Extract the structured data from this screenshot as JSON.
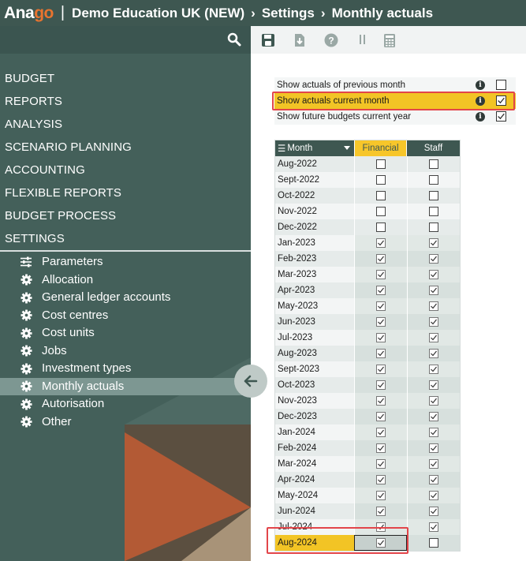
{
  "app": {
    "logo_part1": "Ana",
    "logo_part2": "go",
    "separator": "|",
    "org": "Demo Education UK (NEW)",
    "section": "Settings",
    "page": "Monthly actuals"
  },
  "menu": [
    {
      "label": "BUDGET"
    },
    {
      "label": "REPORTS"
    },
    {
      "label": "ANALYSIS"
    },
    {
      "label": "SCENARIO PLANNING"
    },
    {
      "label": "ACCOUNTING"
    },
    {
      "label": "FLEXIBLE REPORTS"
    },
    {
      "label": "BUDGET PROCESS"
    },
    {
      "label": "SETTINGS"
    }
  ],
  "submenu": [
    {
      "label": "Parameters",
      "icon": "sliders-icon"
    },
    {
      "label": "Allocation",
      "icon": "gear-icon"
    },
    {
      "label": "General ledger accounts",
      "icon": "gear-icon"
    },
    {
      "label": "Cost centres",
      "icon": "gear-icon"
    },
    {
      "label": "Cost units",
      "icon": "gear-icon"
    },
    {
      "label": "Jobs",
      "icon": "gear-icon"
    },
    {
      "label": "Investment types",
      "icon": "gear-icon"
    },
    {
      "label": "Monthly actuals",
      "icon": "gear-icon",
      "active": true
    },
    {
      "label": "Autorisation",
      "icon": "gear-icon"
    },
    {
      "label": "Other",
      "icon": "gear-icon"
    }
  ],
  "toolbar": {
    "icons": [
      "save-icon",
      "download-icon",
      "help-icon",
      "columns-icon",
      "calculator-icon"
    ]
  },
  "options": [
    {
      "label": "Show actuals of previous month",
      "checked": false
    },
    {
      "label": "Show actuals current month",
      "checked": true,
      "highlighted": true
    },
    {
      "label": "Show future budgets current year",
      "checked": true
    }
  ],
  "table": {
    "headers": {
      "month": "Month",
      "financial": "Financial",
      "staff": "Staff"
    },
    "rows": [
      {
        "month": "Aug-2022",
        "financial": false,
        "staff": false
      },
      {
        "month": "Sept-2022",
        "financial": false,
        "staff": false
      },
      {
        "month": "Oct-2022",
        "financial": false,
        "staff": false
      },
      {
        "month": "Nov-2022",
        "financial": false,
        "staff": false
      },
      {
        "month": "Dec-2022",
        "financial": false,
        "staff": false
      },
      {
        "month": "Jan-2023",
        "financial": true,
        "staff": true
      },
      {
        "month": "Feb-2023",
        "financial": true,
        "staff": true
      },
      {
        "month": "Mar-2023",
        "financial": true,
        "staff": true
      },
      {
        "month": "Apr-2023",
        "financial": true,
        "staff": true
      },
      {
        "month": "May-2023",
        "financial": true,
        "staff": true
      },
      {
        "month": "Jun-2023",
        "financial": true,
        "staff": true
      },
      {
        "month": "Jul-2023",
        "financial": true,
        "staff": true
      },
      {
        "month": "Aug-2023",
        "financial": true,
        "staff": true
      },
      {
        "month": "Sept-2023",
        "financial": true,
        "staff": true
      },
      {
        "month": "Oct-2023",
        "financial": true,
        "staff": true
      },
      {
        "month": "Nov-2023",
        "financial": true,
        "staff": true
      },
      {
        "month": "Dec-2023",
        "financial": true,
        "staff": true
      },
      {
        "month": "Jan-2024",
        "financial": true,
        "staff": true
      },
      {
        "month": "Feb-2024",
        "financial": true,
        "staff": true
      },
      {
        "month": "Mar-2024",
        "financial": true,
        "staff": true
      },
      {
        "month": "Apr-2024",
        "financial": true,
        "staff": true
      },
      {
        "month": "May-2024",
        "financial": true,
        "staff": true
      },
      {
        "month": "Jun-2024",
        "financial": true,
        "staff": true
      },
      {
        "month": "Jul-2024",
        "financial": true,
        "staff": true
      },
      {
        "month": "Aug-2024",
        "financial": true,
        "staff": false,
        "selected": true
      }
    ]
  }
}
